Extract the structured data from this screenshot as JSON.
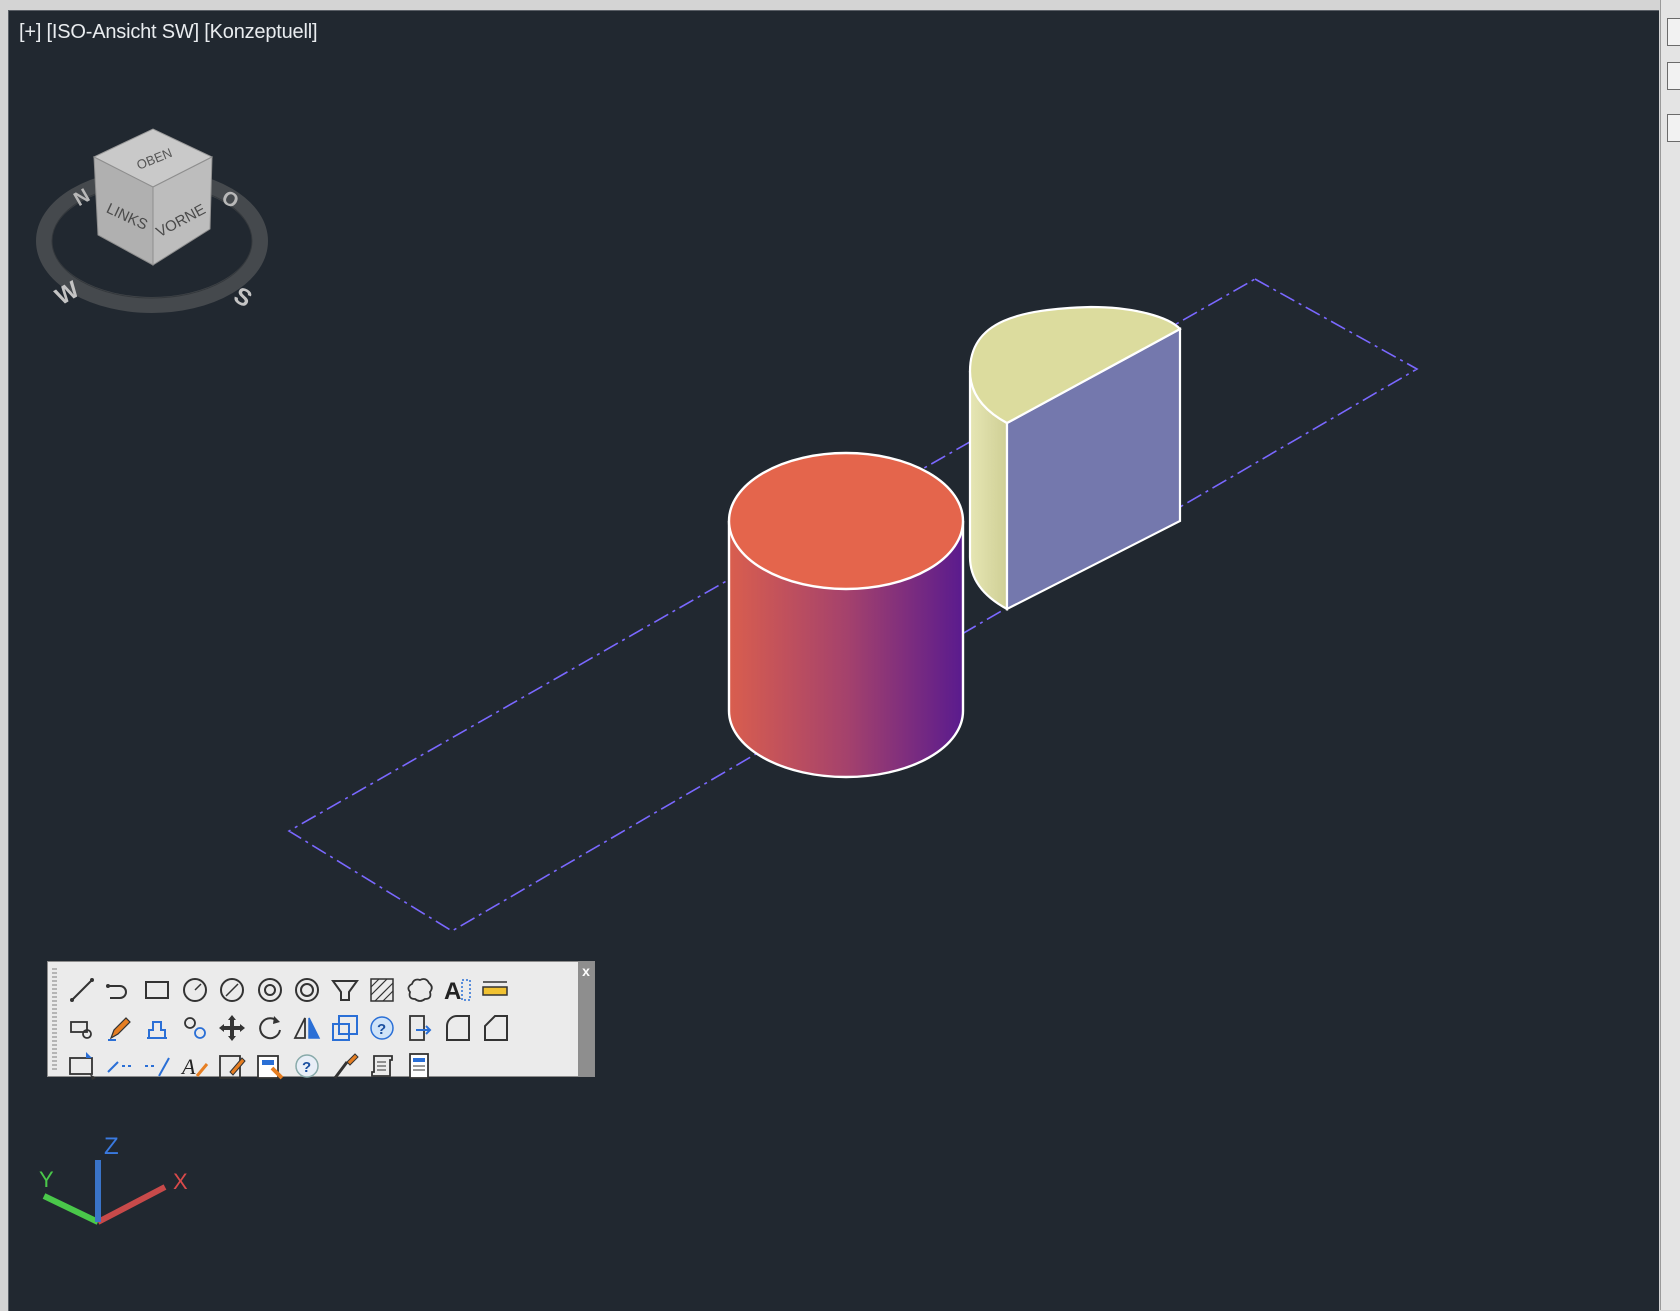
{
  "viewport": {
    "label": "[+] [ISO-Ansicht SW] [Konzeptuell]",
    "background": "#212830"
  },
  "viewcube": {
    "top": "OBEN",
    "left": "LINKS",
    "front": "VORNE",
    "compass": {
      "north": "N",
      "east": "O",
      "south": "S",
      "west": "W"
    }
  },
  "ucs": {
    "x": "X",
    "y": "Y",
    "z": "Z"
  },
  "scene": {
    "cylinder_top_color": "#e4654c",
    "cylinder_side_colors": [
      "#d95e4e",
      "#5a1b8e"
    ],
    "half_cylinder_top_color": "#dcdc9e",
    "half_cylinder_flat_face_color": "#7478ad",
    "boundary_line_color": "#7a68ff"
  },
  "toolbar": {
    "close_label": "x",
    "rows": [
      [
        "line-icon",
        "polyline-icon",
        "rectangle-icon",
        "circle-icon",
        "circle-radius-icon",
        "donut-icon",
        "donut-small-icon",
        "region-icon",
        "hatch-icon",
        "revision-cloud-icon",
        "multiline-text-icon",
        "measure-icon"
      ],
      [
        "block-icon",
        "edit-pencil-icon",
        "stretch-icon",
        "copy-icon",
        "move-icon",
        "rotate-icon",
        "mirror-icon",
        "scale-icon",
        "help-icon",
        "insert-icon",
        "fillet-icon",
        "chamfer-icon"
      ],
      [
        "drawing-area-icon",
        "break-at-point-icon",
        "break-icon",
        "text-style-icon",
        "text-edit-icon",
        "properties-icon",
        "help-2-icon",
        "match-properties-icon",
        "script-icon",
        "list-icon"
      ]
    ]
  }
}
